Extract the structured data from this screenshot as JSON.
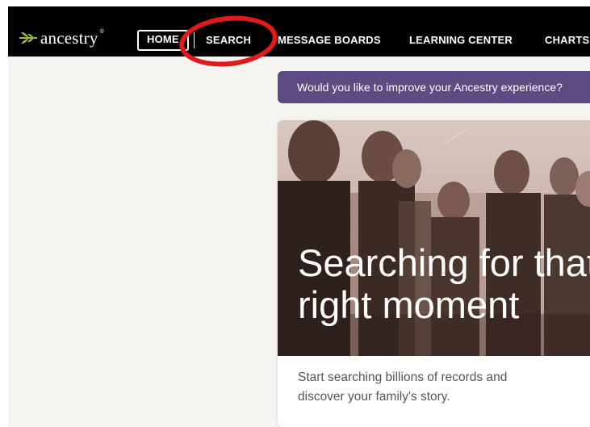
{
  "brand": {
    "name": "ancestry",
    "tm": "®",
    "accent": "#9bbf3a"
  },
  "nav": {
    "items": [
      {
        "label": "HOME"
      },
      {
        "label": "SEARCH"
      },
      {
        "label": "MESSAGE BOARDS"
      },
      {
        "label": "LEARNING CENTER"
      },
      {
        "label": "CHARTS"
      }
    ],
    "highlighted": "SEARCH",
    "highlight_color": "#e01a1a"
  },
  "promo": {
    "text": "Would you like to improve your Ancestry experience?",
    "color": "#5e4b82"
  },
  "card": {
    "headline_line1": "Searching for that",
    "headline_line2": "right moment",
    "body_line1": "Start searching billions of records and",
    "body_line2": "discover your family's story."
  }
}
